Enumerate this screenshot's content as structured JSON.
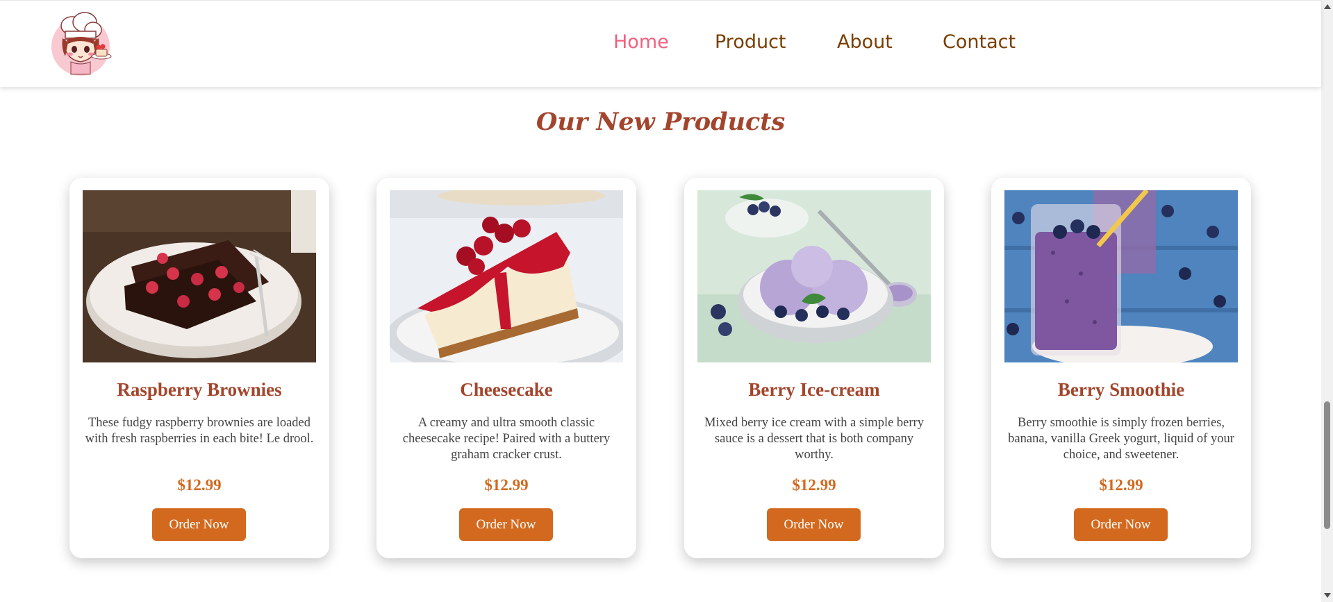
{
  "header": {
    "nav": [
      {
        "label": "Home",
        "active": true
      },
      {
        "label": "Product",
        "active": false
      },
      {
        "label": "About",
        "active": false
      },
      {
        "label": "Contact",
        "active": false
      }
    ],
    "logo_icon": "chef-girl-logo-icon"
  },
  "section": {
    "title": "Our New Products"
  },
  "products": [
    {
      "name": "Raspberry Brownies",
      "description": "These fudgy raspberry brownies are loaded with fresh raspberries in each bite! Le drool.",
      "price": "$12.99",
      "button": "Order Now",
      "image_icon": "raspberry-brownies-image"
    },
    {
      "name": "Cheesecake",
      "description": "A creamy and ultra smooth classic cheesecake recipe! Paired with a buttery graham cracker crust.",
      "price": "$12.99",
      "button": "Order Now",
      "image_icon": "cheesecake-image"
    },
    {
      "name": "Berry Ice-cream",
      "description": "Mixed berry ice cream with a simple berry sauce is a dessert that is both company worthy.",
      "price": "$12.99",
      "button": "Order Now",
      "image_icon": "berry-ice-cream-image"
    },
    {
      "name": "Berry Smoothie",
      "description": "Berry smoothie is simply frozen berries, banana, vanilla Greek yogurt, liquid of your choice, and sweetener.",
      "price": "$12.99",
      "button": "Order Now",
      "image_icon": "berry-smoothie-image"
    }
  ],
  "colors": {
    "nav_active": "#f0617f",
    "nav_text": "#7a3f00",
    "title": "#a3452c",
    "accent": "#d2691e"
  }
}
